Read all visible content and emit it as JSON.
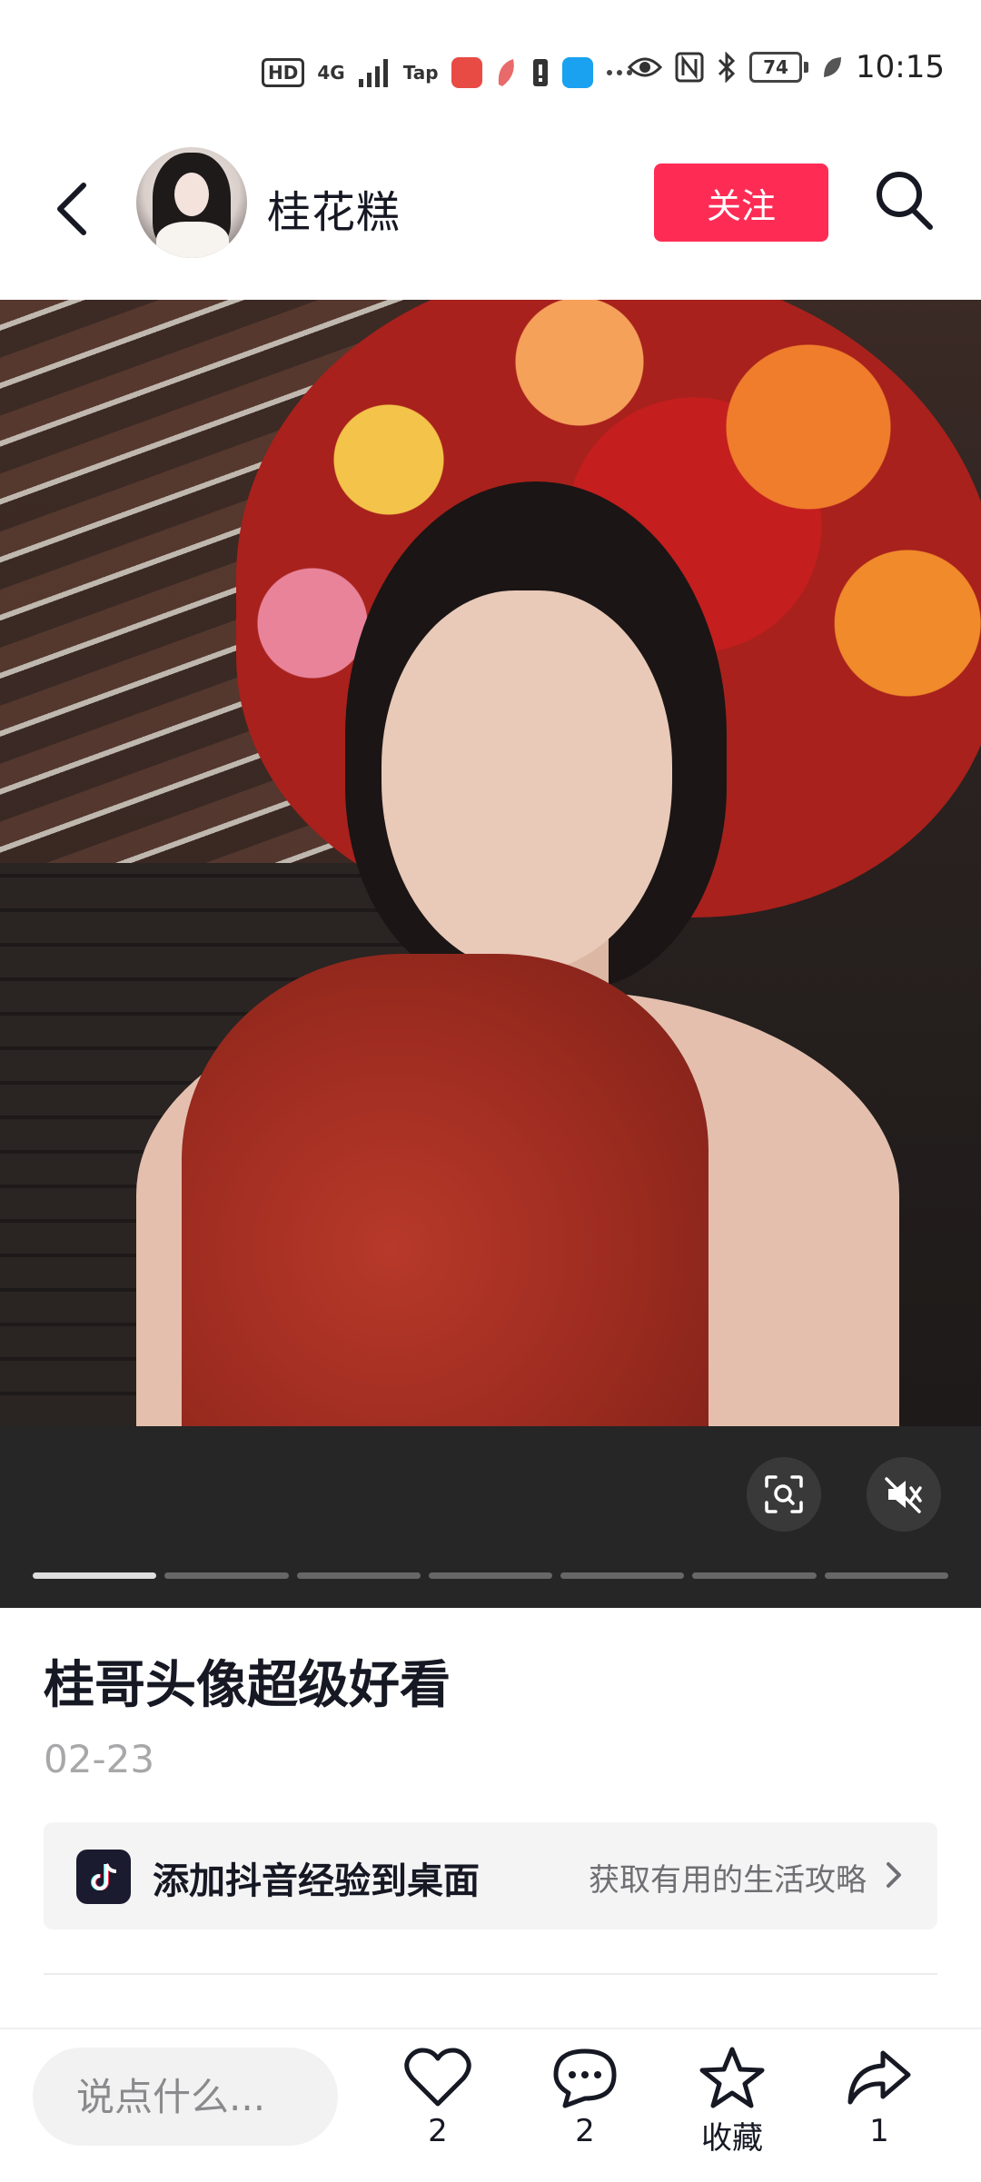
{
  "status_bar": {
    "left_badges": [
      "HD",
      "4G",
      "Tap"
    ],
    "battery": "74",
    "time": "10:15"
  },
  "header": {
    "author_name": "桂花糕",
    "follow_label": "关注"
  },
  "media": {
    "total_pages": 7,
    "current_page": 1
  },
  "post": {
    "title": "桂哥头像超级好看",
    "date": "02-23"
  },
  "banner": {
    "title": "添加抖音经验到桌面",
    "subtitle": "获取有用的生活攻略"
  },
  "bottom_bar": {
    "comment_placeholder": "说点什么...",
    "like_count": "2",
    "comment_count": "2",
    "favorite_label": "收藏",
    "share_count": "1"
  },
  "colors": {
    "accent": "#fe2c55",
    "text_primary": "#161823",
    "text_secondary": "#a8a8aa"
  }
}
